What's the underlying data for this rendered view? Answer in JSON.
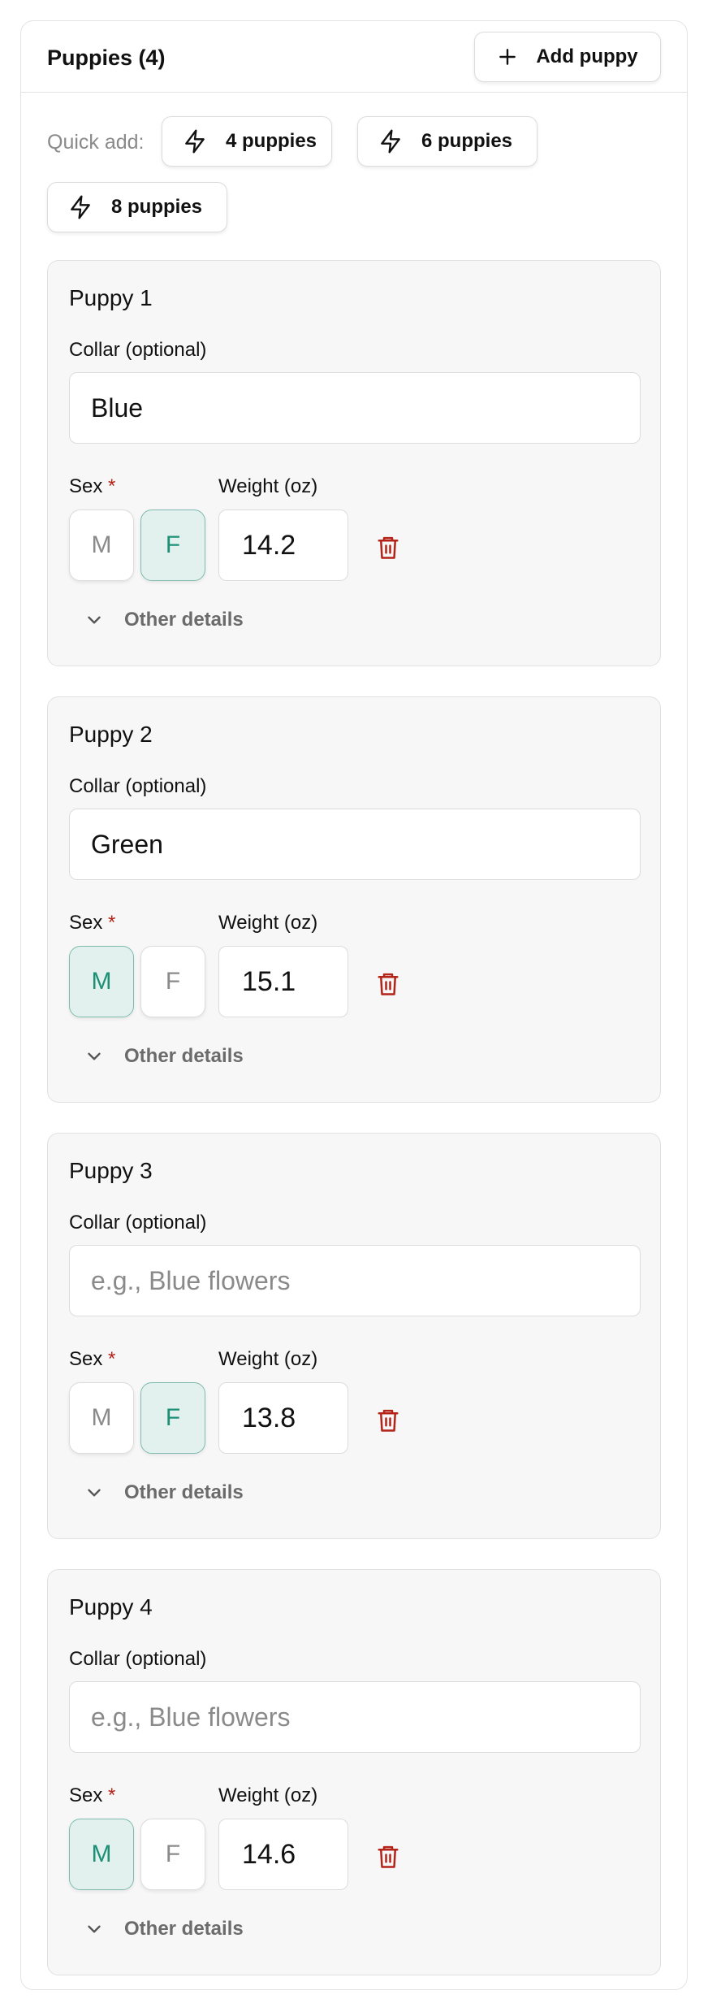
{
  "header": {
    "title": "Puppies (4)",
    "add_label": "Add puppy"
  },
  "quick_add": {
    "label": "Quick add:",
    "options": [
      {
        "label": "4 puppies"
      },
      {
        "label": "6 puppies"
      },
      {
        "label": "8 puppies"
      }
    ]
  },
  "labels": {
    "collar": "Collar (optional)",
    "sex": "Sex",
    "required_mark": "*",
    "weight": "Weight (oz)",
    "male": "M",
    "female": "F",
    "other_details": "Other details",
    "collar_placeholder": "e.g., Blue flowers"
  },
  "puppies": [
    {
      "title": "Puppy 1",
      "collar": "Blue",
      "sex": "F",
      "weight": "14.2"
    },
    {
      "title": "Puppy 2",
      "collar": "Green",
      "sex": "M",
      "weight": "15.1"
    },
    {
      "title": "Puppy 3",
      "collar": "",
      "sex": "F",
      "weight": "13.8"
    },
    {
      "title": "Puppy 4",
      "collar": "",
      "sex": "M",
      "weight": "14.6"
    }
  ],
  "colors": {
    "accent": "#1b9077",
    "accent_bg": "#e3f1ee",
    "danger": "#b42318"
  },
  "icons": {
    "add": "plus-icon",
    "quick": "bolt-icon",
    "delete": "trash-icon",
    "expand": "chevron-down-icon"
  }
}
